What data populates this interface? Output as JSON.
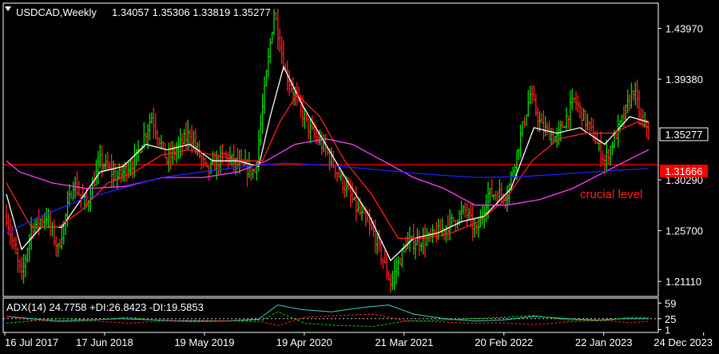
{
  "chart_data": {
    "type": "candlestick",
    "title": "USDCAD,Weekly",
    "ohlc_label": "1.34057 1.35306 1.33819 1.35277",
    "colors": {
      "background": "#000000",
      "frame": "#ffffff",
      "bull": "#00dd00",
      "bear": "#ff2020",
      "ma_fast": "#ffffff",
      "ma_mid": "#ff2020",
      "ma_slow": "#ff40ff",
      "ma_long": "#2020ff",
      "level": "#ff0000",
      "adx": "#40d0c0",
      "plus_di": "#00cc00",
      "minus_di": "#ff2020"
    },
    "y_axis": {
      "ticks": [
        1.2111,
        1.257,
        1.3029,
        1.3938,
        1.4397
      ],
      "tick_labels": [
        "1.21110",
        "1.25700",
        "1.30290",
        "1.39380",
        "1.43970"
      ],
      "range": [
        1.1975,
        1.4625
      ]
    },
    "x_axis": {
      "tick_labels": [
        "16 Jul 2017",
        "17 Jun 2018",
        "19 May 2019",
        "19 Apr 2020",
        "21 Mar 2021",
        "20 Feb 2022",
        "22 Jan 2023",
        "24 Dec 2023"
      ],
      "range": [
        "2017-07-16",
        "2023-12-24"
      ]
    },
    "price_marker": {
      "value": 1.35277,
      "label": "1.35277"
    },
    "horizontal_level": {
      "value": 1.31666,
      "label": "1.31666",
      "annotation": "crucial level"
    },
    "price_path": [
      [
        "2017-07-16",
        1.27
      ],
      [
        "2017-08-13",
        1.24
      ],
      [
        "2017-09-10",
        1.215
      ],
      [
        "2017-10-15",
        1.26
      ],
      [
        "2017-12-10",
        1.27
      ],
      [
        "2018-01-21",
        1.24
      ],
      [
        "2018-03-18",
        1.3
      ],
      [
        "2018-05-06",
        1.28
      ],
      [
        "2018-06-24",
        1.32
      ],
      [
        "2018-08-26",
        1.305
      ],
      [
        "2018-10-28",
        1.32
      ],
      [
        "2018-12-30",
        1.36
      ],
      [
        "2019-02-24",
        1.32
      ],
      [
        "2019-05-19",
        1.345
      ],
      [
        "2019-07-21",
        1.31
      ],
      [
        "2019-09-22",
        1.325
      ],
      [
        "2019-11-24",
        1.315
      ],
      [
        "2020-01-12",
        1.31
      ],
      [
        "2020-03-22",
        1.455
      ],
      [
        "2020-05-03",
        1.4
      ],
      [
        "2020-07-26",
        1.35
      ],
      [
        "2020-09-27",
        1.33
      ],
      [
        "2020-11-29",
        1.3
      ],
      [
        "2021-01-24",
        1.275
      ],
      [
        "2021-03-21",
        1.255
      ],
      [
        "2021-05-23",
        1.21
      ],
      [
        "2021-07-18",
        1.245
      ],
      [
        "2021-10-17",
        1.25
      ],
      [
        "2022-01-02",
        1.265
      ],
      [
        "2022-02-20",
        1.275
      ],
      [
        "2022-04-03",
        1.255
      ],
      [
        "2022-05-15",
        1.29
      ],
      [
        "2022-07-24",
        1.29
      ],
      [
        "2022-10-16",
        1.38
      ],
      [
        "2022-11-27",
        1.35
      ],
      [
        "2023-01-22",
        1.34
      ],
      [
        "2023-03-26",
        1.375
      ],
      [
        "2023-05-21",
        1.35
      ],
      [
        "2023-07-16",
        1.32
      ],
      [
        "2023-09-24",
        1.36
      ],
      [
        "2023-10-29",
        1.385
      ],
      [
        "2023-12-03",
        1.35
      ],
      [
        "2023-12-24",
        1.35277
      ]
    ],
    "moving_averages": [
      {
        "key": "ma_fast",
        "points": [
          [
            "2017-07-16",
            1.29
          ],
          [
            "2017-09-10",
            1.24
          ],
          [
            "2017-11-19",
            1.26
          ],
          [
            "2018-02-04",
            1.26
          ],
          [
            "2018-04-15",
            1.285
          ],
          [
            "2018-06-24",
            1.31
          ],
          [
            "2018-09-16",
            1.315
          ],
          [
            "2018-12-09",
            1.335
          ],
          [
            "2019-02-24",
            1.33
          ],
          [
            "2019-05-19",
            1.335
          ],
          [
            "2019-08-11",
            1.32
          ],
          [
            "2019-11-10",
            1.32
          ],
          [
            "2020-01-26",
            1.315
          ],
          [
            "2020-03-08",
            1.36
          ],
          [
            "2020-04-26",
            1.405
          ],
          [
            "2020-07-05",
            1.37
          ],
          [
            "2020-09-27",
            1.335
          ],
          [
            "2020-12-20",
            1.3
          ],
          [
            "2021-03-07",
            1.27
          ],
          [
            "2021-05-23",
            1.23
          ],
          [
            "2021-08-15",
            1.25
          ],
          [
            "2021-11-14",
            1.255
          ],
          [
            "2022-02-06",
            1.265
          ],
          [
            "2022-05-01",
            1.27
          ],
          [
            "2022-08-07",
            1.295
          ],
          [
            "2022-10-30",
            1.35
          ],
          [
            "2023-01-22",
            1.345
          ],
          [
            "2023-04-16",
            1.35
          ],
          [
            "2023-07-16",
            1.335
          ],
          [
            "2023-10-15",
            1.36
          ],
          [
            "2023-12-24",
            1.355
          ]
        ]
      },
      {
        "key": "ma_mid",
        "points": [
          [
            "2017-07-16",
            1.3
          ],
          [
            "2017-10-15",
            1.26
          ],
          [
            "2018-01-21",
            1.26
          ],
          [
            "2018-04-15",
            1.275
          ],
          [
            "2018-07-22",
            1.3
          ],
          [
            "2018-10-28",
            1.31
          ],
          [
            "2019-02-03",
            1.325
          ],
          [
            "2019-05-12",
            1.33
          ],
          [
            "2019-08-18",
            1.325
          ],
          [
            "2019-11-24",
            1.32
          ],
          [
            "2020-02-09",
            1.32
          ],
          [
            "2020-04-12",
            1.355
          ],
          [
            "2020-06-14",
            1.38
          ],
          [
            "2020-09-06",
            1.36
          ],
          [
            "2020-12-06",
            1.32
          ],
          [
            "2021-03-14",
            1.29
          ],
          [
            "2021-06-20",
            1.25
          ],
          [
            "2021-09-26",
            1.25
          ],
          [
            "2022-01-02",
            1.255
          ],
          [
            "2022-04-10",
            1.265
          ],
          [
            "2022-07-17",
            1.285
          ],
          [
            "2022-10-23",
            1.32
          ],
          [
            "2023-01-29",
            1.34
          ],
          [
            "2023-05-07",
            1.345
          ],
          [
            "2023-08-13",
            1.345
          ],
          [
            "2023-11-12",
            1.355
          ],
          [
            "2023-12-24",
            1.35
          ]
        ]
      },
      {
        "key": "ma_slow",
        "points": [
          [
            "2017-07-16",
            1.32
          ],
          [
            "2017-09-03",
            1.31
          ],
          [
            "2017-12-31",
            1.3
          ],
          [
            "2018-05-06",
            1.295
          ],
          [
            "2018-09-23",
            1.297
          ],
          [
            "2019-02-10",
            1.305
          ],
          [
            "2019-07-07",
            1.305
          ],
          [
            "2019-11-10",
            1.31
          ],
          [
            "2020-02-23",
            1.32
          ],
          [
            "2020-06-07",
            1.335
          ],
          [
            "2020-09-27",
            1.34
          ],
          [
            "2021-01-03",
            1.335
          ],
          [
            "2021-04-25",
            1.32
          ],
          [
            "2021-08-15",
            1.305
          ],
          [
            "2021-12-05",
            1.295
          ],
          [
            "2022-03-27",
            1.28
          ],
          [
            "2022-07-24",
            1.28
          ],
          [
            "2022-11-20",
            1.285
          ],
          [
            "2023-03-19",
            1.295
          ],
          [
            "2023-07-16",
            1.31
          ],
          [
            "2023-11-12",
            1.325
          ],
          [
            "2023-12-24",
            1.33
          ]
        ]
      },
      {
        "key": "ma_long",
        "points": [
          [
            "2017-07-16",
            1.255
          ],
          [
            "2017-11-19",
            1.27
          ],
          [
            "2018-04-15",
            1.285
          ],
          [
            "2018-09-09",
            1.295
          ],
          [
            "2019-02-03",
            1.305
          ],
          [
            "2019-06-30",
            1.31
          ],
          [
            "2019-12-08",
            1.315
          ],
          [
            "2020-05-03",
            1.318
          ],
          [
            "2020-10-04",
            1.316
          ],
          [
            "2021-04-04",
            1.312
          ],
          [
            "2021-10-03",
            1.308
          ],
          [
            "2022-04-03",
            1.305
          ],
          [
            "2022-10-02",
            1.306
          ],
          [
            "2023-04-02",
            1.309
          ],
          [
            "2023-10-01",
            1.312
          ],
          [
            "2023-12-24",
            1.313
          ]
        ]
      }
    ],
    "indicator": {
      "name": "ADX(14)",
      "label": "ADX(14) 24.7758 +DI:26.8423 -DI:19.5853",
      "ticks": [
        1,
        25,
        59
      ],
      "tick_labels": [
        "1",
        "25",
        "59"
      ],
      "range": [
        -5,
        70
      ],
      "dotted_level": 25,
      "adx": [
        [
          "2017-07-16",
          30
        ],
        [
          "2017-10-15",
          25
        ],
        [
          "2018-01-21",
          20
        ],
        [
          "2018-05-06",
          22
        ],
        [
          "2018-09-09",
          25
        ],
        [
          "2019-01-13",
          22
        ],
        [
          "2019-05-19",
          20
        ],
        [
          "2019-09-22",
          20
        ],
        [
          "2020-01-26",
          24
        ],
        [
          "2020-04-05",
          55
        ],
        [
          "2020-06-28",
          45
        ],
        [
          "2020-10-18",
          40
        ],
        [
          "2021-02-14",
          50
        ],
        [
          "2021-05-16",
          55
        ],
        [
          "2021-08-15",
          35
        ],
        [
          "2021-12-05",
          25
        ],
        [
          "2022-03-27",
          20
        ],
        [
          "2022-07-10",
          22
        ],
        [
          "2022-10-30",
          30
        ],
        [
          "2023-02-26",
          25
        ],
        [
          "2023-06-18",
          22
        ],
        [
          "2023-09-24",
          25
        ],
        [
          "2023-12-24",
          24.7758
        ]
      ],
      "plus_di": [
        [
          "2017-07-16",
          15
        ],
        [
          "2017-10-15",
          20
        ],
        [
          "2018-02-04",
          25
        ],
        [
          "2018-06-03",
          22
        ],
        [
          "2018-10-07",
          28
        ],
        [
          "2019-02-10",
          20
        ],
        [
          "2019-06-09",
          18
        ],
        [
          "2019-10-13",
          20
        ],
        [
          "2020-02-09",
          22
        ],
        [
          "2020-04-05",
          40
        ],
        [
          "2020-07-12",
          15
        ],
        [
          "2020-11-15",
          10
        ],
        [
          "2021-03-21",
          8
        ],
        [
          "2021-07-18",
          20
        ],
        [
          "2021-11-21",
          22
        ],
        [
          "2022-03-13",
          25
        ],
        [
          "2022-07-10",
          28
        ],
        [
          "2022-10-30",
          32
        ],
        [
          "2023-03-05",
          22
        ],
        [
          "2023-07-09",
          20
        ],
        [
          "2023-10-15",
          28
        ],
        [
          "2023-12-24",
          26.8423
        ]
      ],
      "minus_di": [
        [
          "2017-07-16",
          30
        ],
        [
          "2017-10-15",
          22
        ],
        [
          "2018-02-04",
          18
        ],
        [
          "2018-06-03",
          20
        ],
        [
          "2018-10-07",
          15
        ],
        [
          "2019-02-10",
          20
        ],
        [
          "2019-06-09",
          22
        ],
        [
          "2019-10-13",
          20
        ],
        [
          "2020-02-09",
          18
        ],
        [
          "2020-04-05",
          10
        ],
        [
          "2020-07-12",
          28
        ],
        [
          "2020-11-15",
          32
        ],
        [
          "2021-03-21",
          35
        ],
        [
          "2021-07-18",
          20
        ],
        [
          "2021-11-21",
          18
        ],
        [
          "2022-03-13",
          15
        ],
        [
          "2022-07-10",
          16
        ],
        [
          "2022-10-30",
          12
        ],
        [
          "2023-03-05",
          18
        ],
        [
          "2023-07-09",
          22
        ],
        [
          "2023-10-15",
          16
        ],
        [
          "2023-12-24",
          19.5853
        ]
      ]
    }
  }
}
